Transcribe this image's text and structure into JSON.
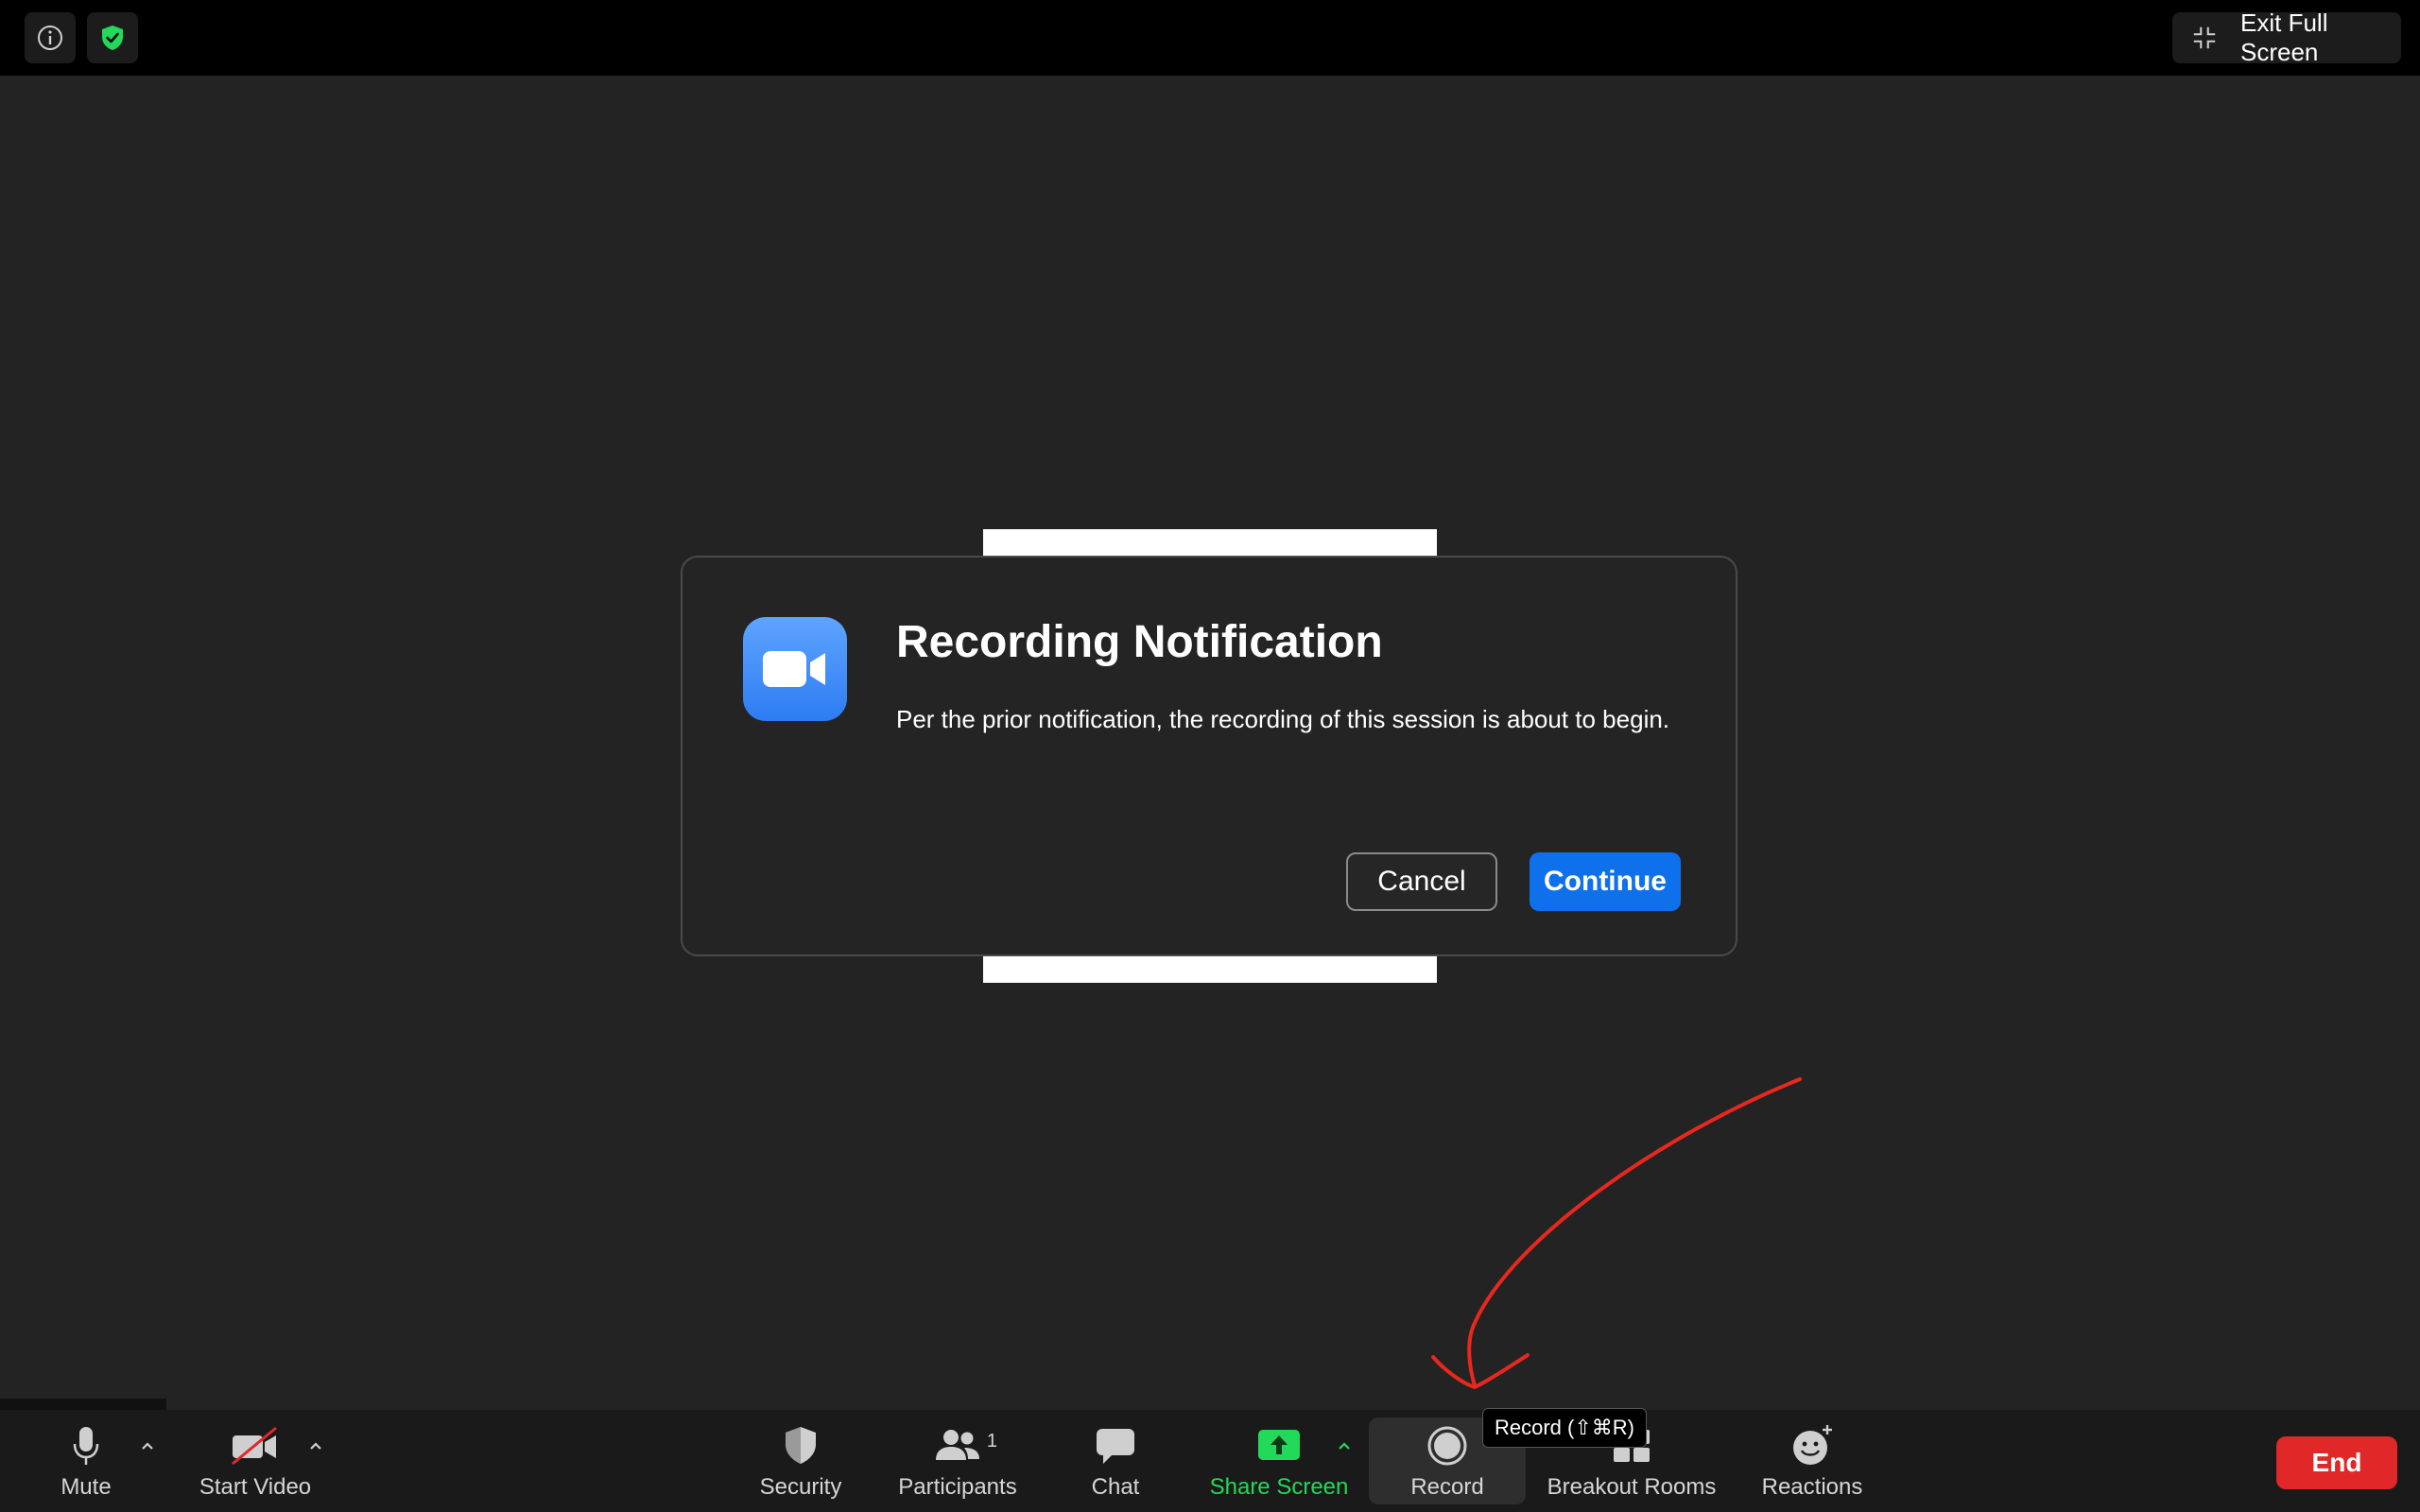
{
  "topbar": {
    "info_icon": "info-icon",
    "security_shield_icon": "shield-check-icon",
    "exit_fullscreen_label": "Exit Full Screen"
  },
  "dialog": {
    "title": "Recording Notification",
    "message": "Per the prior notification, the recording of this session is about to begin.",
    "cancel_label": "Cancel",
    "continue_label": "Continue",
    "app_icon": "zoom-video-camera-icon"
  },
  "toolbar": {
    "mute_label": "Mute",
    "start_video_label": "Start Video",
    "security_label": "Security",
    "participants_label": "Participants",
    "participants_count": "1",
    "chat_label": "Chat",
    "share_screen_label": "Share Screen",
    "record_label": "Record",
    "breakout_rooms_label": "Breakout Rooms",
    "reactions_label": "Reactions",
    "end_label": "End",
    "record_tooltip": "Record (⇧⌘R)"
  },
  "colors": {
    "accent_blue": "#0e71eb",
    "share_green": "#23d959",
    "end_red": "#e02828",
    "annotation_red": "#e8281e",
    "shield_green": "#23d959"
  }
}
